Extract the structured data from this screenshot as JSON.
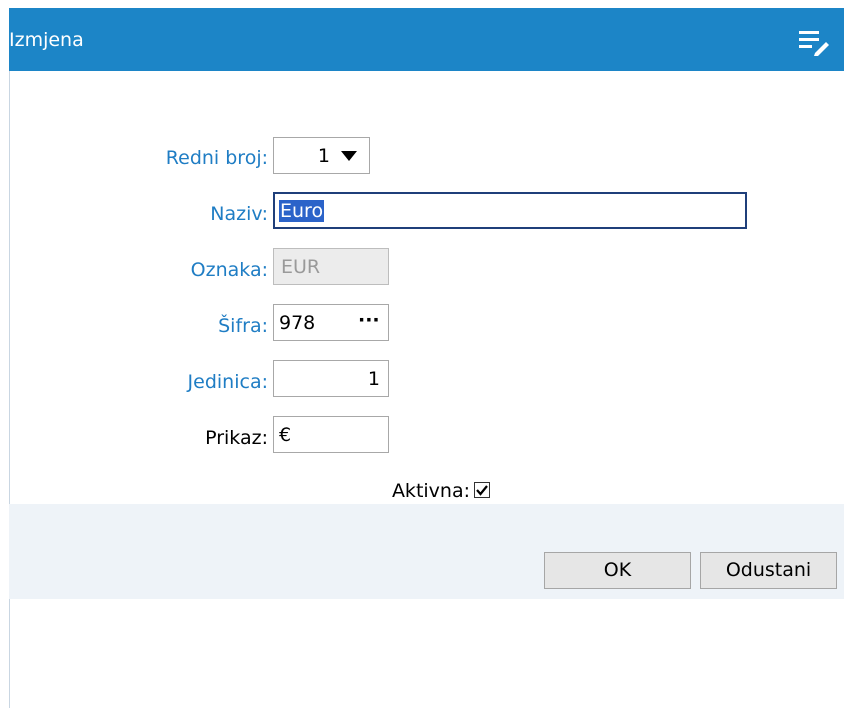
{
  "dialog": {
    "title": "Izmjena"
  },
  "form": {
    "redni_broj": {
      "label": "Redni broj:",
      "value": "1"
    },
    "naziv": {
      "label": "Naziv:",
      "value": "Euro"
    },
    "oznaka": {
      "label": "Oznaka:",
      "value": "EUR"
    },
    "sifra": {
      "label": "Šifra:",
      "value": "978",
      "button": "···"
    },
    "jedinica": {
      "label": "Jedinica:",
      "value": "1"
    },
    "prikaz": {
      "label": "Prikaz:",
      "value": "€"
    },
    "aktivna": {
      "label": "Aktivna:",
      "checked": true
    }
  },
  "buttons": {
    "ok": "OK",
    "cancel": "Odustani"
  },
  "colors": {
    "titlebar": "#1c85c7",
    "label_blue": "#1f7dc4",
    "footer": "#eef3f8"
  }
}
